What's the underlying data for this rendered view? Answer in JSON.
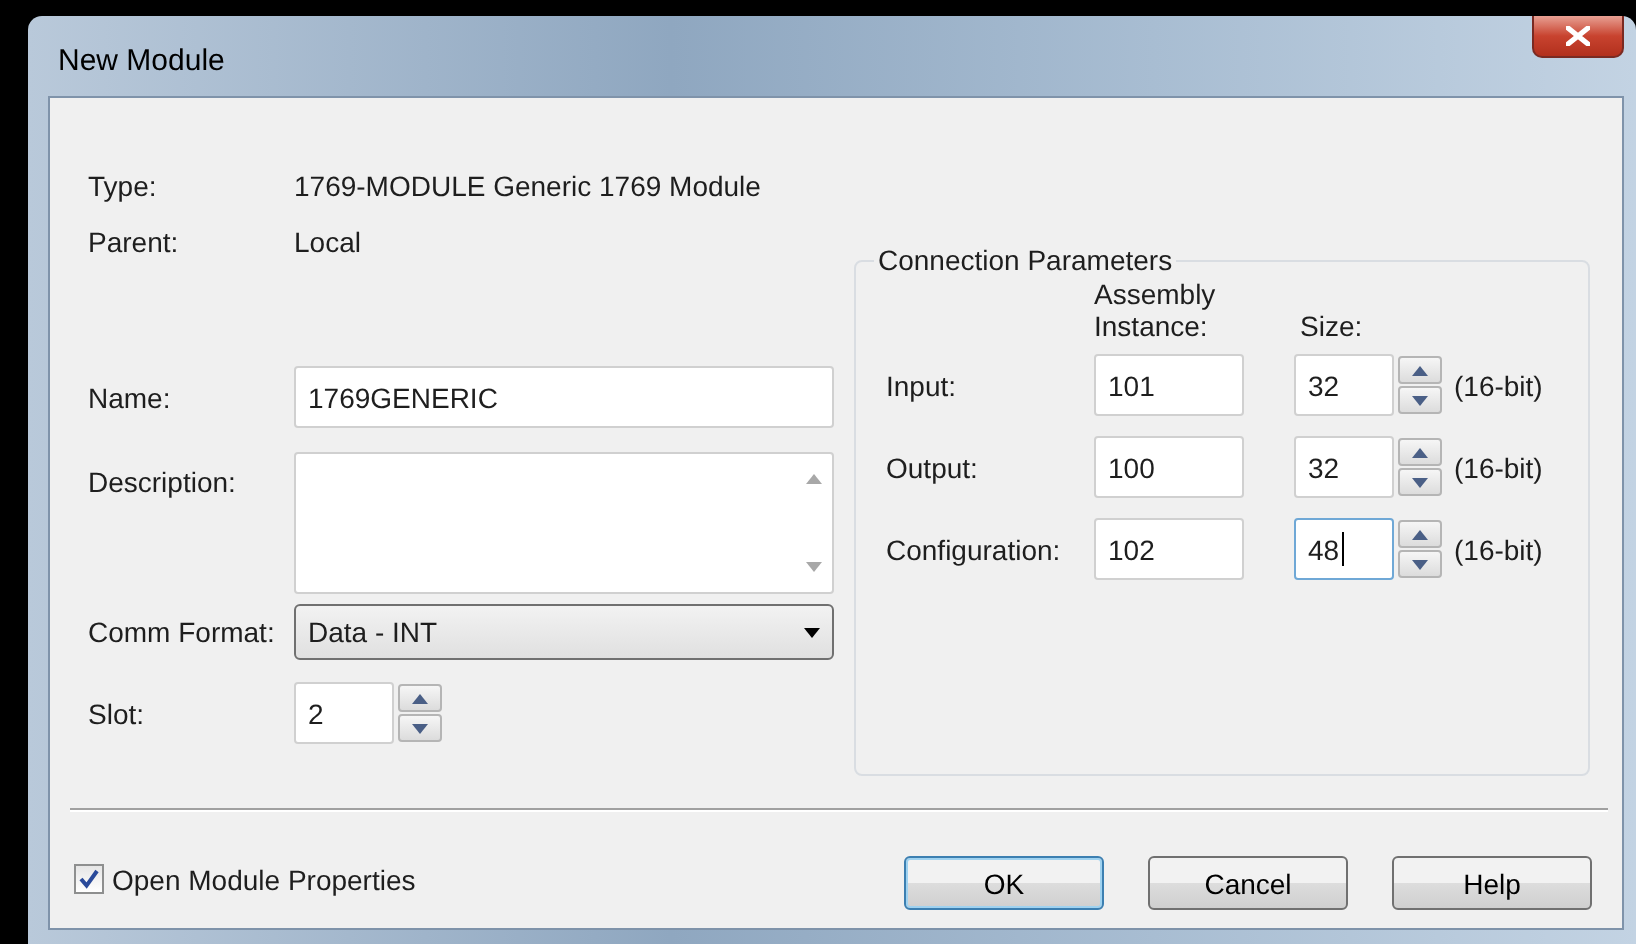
{
  "window": {
    "title": "New Module"
  },
  "info": [
    {
      "label": "Type:",
      "value": "1769-MODULE Generic 1769 Module"
    },
    {
      "label": "Parent:",
      "value": "Local"
    }
  ],
  "name": {
    "label": "Name:",
    "value": "1769GENERIC"
  },
  "description": {
    "label": "Description:"
  },
  "comm_format": {
    "label": "Comm Format:",
    "value": "Data - INT"
  },
  "slot": {
    "label": "Slot:",
    "value": "2"
  },
  "connection_parameters": {
    "title": "Connection Parameters",
    "columns": [
      "Assembly Instance:",
      "Size:"
    ],
    "rows": [
      {
        "label": "Input:",
        "instance": "101",
        "size": "32",
        "unit": "(16-bit)",
        "focused": false
      },
      {
        "label": "Output:",
        "instance": "100",
        "size": "32",
        "unit": "(16-bit)",
        "focused": false
      },
      {
        "label": "Configuration:",
        "instance": "102",
        "size": "48",
        "unit": "(16-bit)",
        "focused": true
      }
    ]
  },
  "open_module_properties": {
    "label": "Open Module Properties",
    "checked": true
  },
  "buttons": [
    {
      "label": "OK",
      "default": true
    },
    {
      "label": "Cancel",
      "default": false
    },
    {
      "label": "Help",
      "default": false
    }
  ]
}
